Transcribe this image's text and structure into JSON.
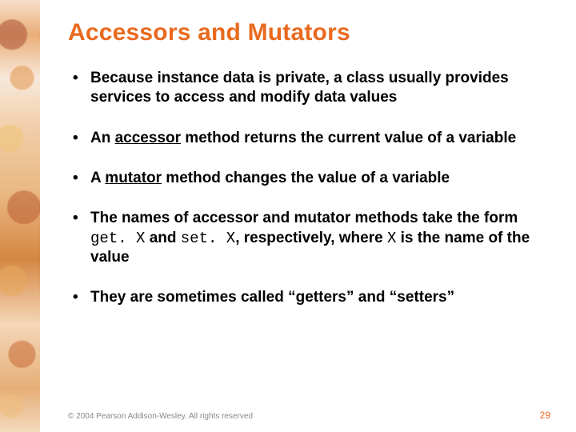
{
  "title": "Accessors and Mutators",
  "bullets": {
    "b1": "Because instance data is private, a class usually provides services to access and modify data values",
    "b2_pre": "An ",
    "b2_u": "accessor",
    "b2_post": " method returns the current value of a variable",
    "b3_pre": "A ",
    "b3_u": "mutator",
    "b3_post": " method changes the value of a variable",
    "b4_pre": "The names of accessor and mutator methods take the form ",
    "b4_code1": "get. X",
    "b4_mid": " and ",
    "b4_code2": "set. X",
    "b4_post1": ", respectively, where ",
    "b4_code3": "X",
    "b4_post2": " is the name of the value",
    "b5": "They are sometimes called “getters” and “setters”"
  },
  "footer": {
    "copyright": "© 2004 Pearson Addison-Wesley. All rights reserved",
    "page": "29"
  }
}
